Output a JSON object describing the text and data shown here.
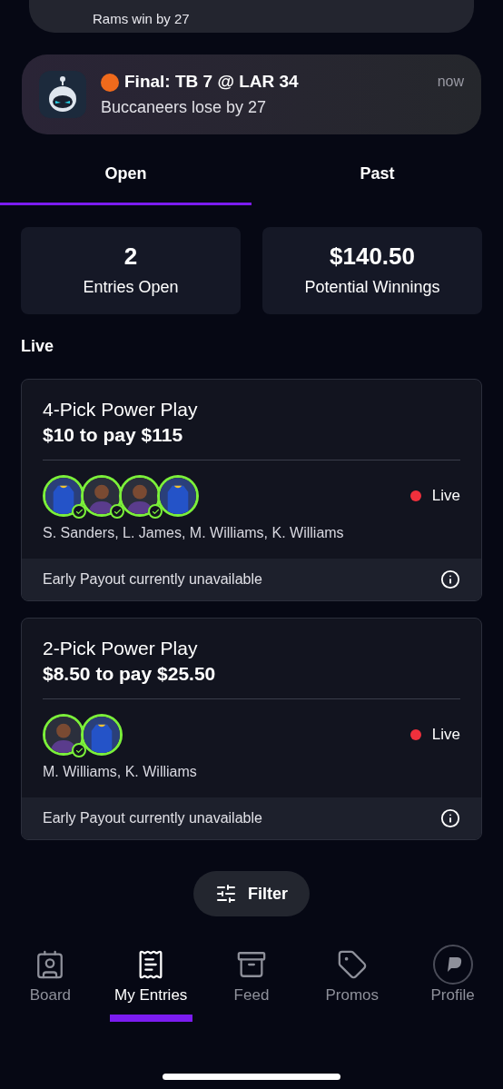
{
  "top_banner": {
    "text": "Rams win by 27"
  },
  "notification": {
    "title": "Final: TB 7 @ LAR 34",
    "body": "Buccaneers lose by 27",
    "time": "now"
  },
  "tabs": [
    {
      "label": "Open",
      "selected": true
    },
    {
      "label": "Past",
      "selected": false
    }
  ],
  "stats": [
    {
      "value": "2",
      "label": "Entries Open"
    },
    {
      "value": "$140.50",
      "label": "Potential Winnings"
    }
  ],
  "section_title": "Live",
  "entries": [
    {
      "title": "4-Pick Power Play",
      "stake": "$10 to pay $115",
      "status": "Live",
      "players": "S. Sanders, L. James, M. Williams, K. Williams",
      "picks": [
        {
          "kind": "jersey",
          "checked": true
        },
        {
          "kind": "person",
          "checked": true
        },
        {
          "kind": "person",
          "checked": true
        },
        {
          "kind": "jersey",
          "checked": false
        }
      ],
      "footer": "Early Payout currently unavailable"
    },
    {
      "title": "2-Pick Power Play",
      "stake": "$8.50 to pay $25.50",
      "status": "Live",
      "players": "M. Williams, K. Williams",
      "picks": [
        {
          "kind": "person",
          "checked": true
        },
        {
          "kind": "jersey",
          "checked": false
        }
      ],
      "footer": "Early Payout currently unavailable"
    }
  ],
  "filter_button": "Filter",
  "nav": [
    {
      "label": "Board",
      "selected": false
    },
    {
      "label": "My Entries",
      "selected": true
    },
    {
      "label": "Feed",
      "selected": false
    },
    {
      "label": "Promos",
      "selected": false
    },
    {
      "label": "Profile",
      "selected": false
    }
  ]
}
